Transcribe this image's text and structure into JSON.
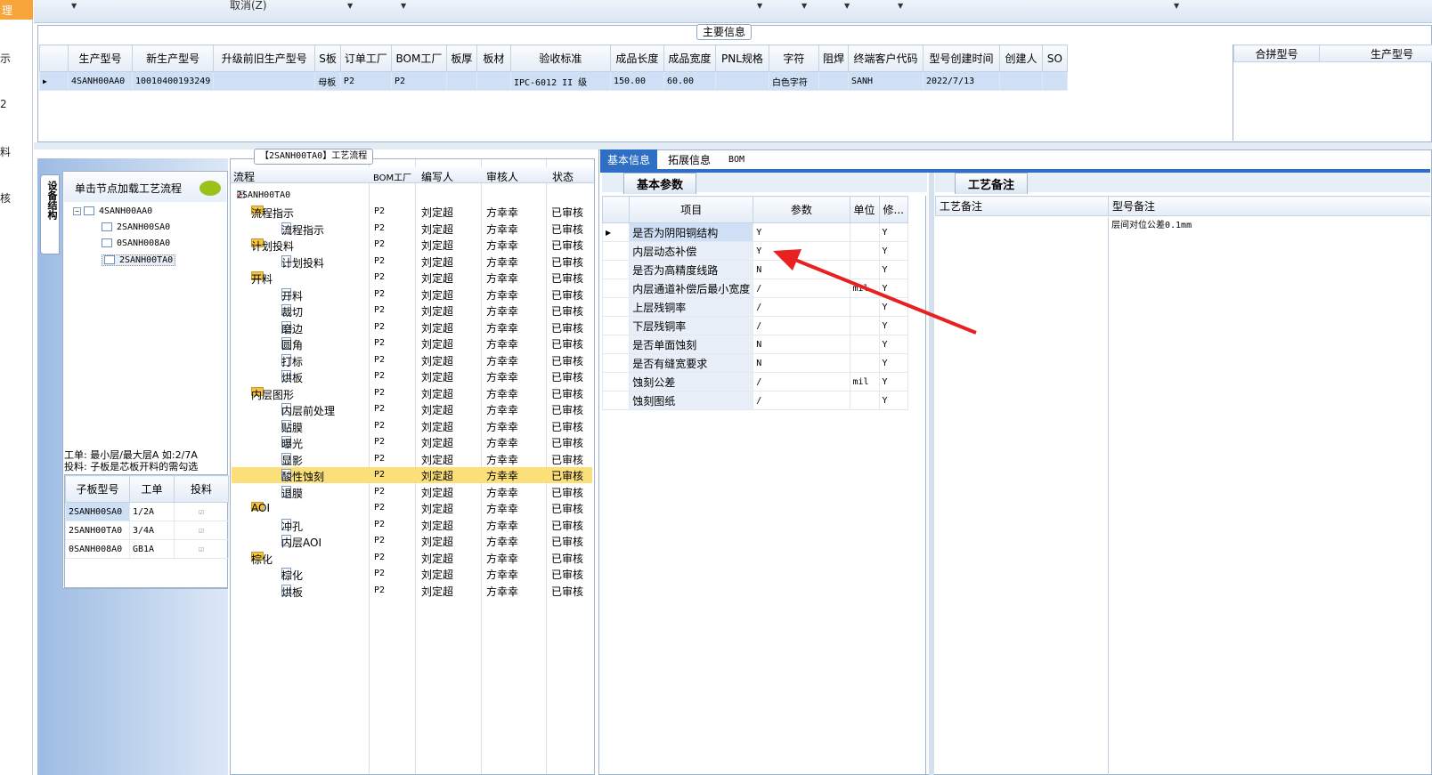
{
  "leftnav": {
    "items": [
      "理",
      "示",
      "2",
      "料",
      "核"
    ]
  },
  "topbar": {
    "cancel_label": "取消(Z)"
  },
  "main_info": {
    "legend": "主要信息",
    "columns": [
      "生产型号",
      "新生产型号",
      "升级前旧生产型号",
      "S板",
      "订单工厂",
      "BOM工厂",
      "板厚",
      "板材",
      "验收标准",
      "成品长度",
      "成品宽度",
      "PNL规格",
      "字符",
      "阻焊",
      "终端客户代码",
      "型号创建时间",
      "创建人",
      "SO"
    ],
    "row": [
      "4SANH00AA0",
      "10010400193249",
      "",
      "母板",
      "P2",
      "P2",
      "",
      "",
      "IPC-6012 II 级",
      "150.00",
      "60.00",
      "",
      "白色字符",
      "",
      "SANH",
      "2022/7/13",
      "",
      ""
    ],
    "right_columns": [
      "合拼型号",
      "生产型号"
    ]
  },
  "structure": {
    "vtab": "设备结构",
    "hint": "单击节点加载工艺流程",
    "tree": [
      "4SANH00AA0",
      "2SANH00SA0",
      "0SANH008A0",
      "2SANH00TA0"
    ],
    "note_line1": "工单: 最小层/最大层A 如:2/7A",
    "note_line2": "投料: 子板是芯板开料的需勾选",
    "sub_columns": [
      "子板型号",
      "工单",
      "投料"
    ],
    "sub_rows": [
      {
        "model": "2SANH00SA0",
        "order": "1/2A"
      },
      {
        "model": "2SANH00TA0",
        "order": "3/4A"
      },
      {
        "model": "0SANH008A0",
        "order": "GB1A"
      }
    ]
  },
  "flow": {
    "legend": "【2SANH00TA0】工艺流程",
    "columns": [
      "流程",
      "BOM工厂",
      "编写人",
      "审核人",
      "状态"
    ],
    "root": "2SANH00TA0",
    "rows": [
      {
        "name": "流程指示",
        "level": 1,
        "folder": true,
        "bom": "P2",
        "author": "刘定超",
        "reviewer": "方幸幸",
        "status": "已审核"
      },
      {
        "name": "流程指示",
        "level": 2,
        "folder": false,
        "bom": "P2",
        "author": "刘定超",
        "reviewer": "方幸幸",
        "status": "已审核"
      },
      {
        "name": "计划投料",
        "level": 1,
        "folder": true,
        "bom": "P2",
        "author": "刘定超",
        "reviewer": "方幸幸",
        "status": "已审核"
      },
      {
        "name": "计划投料",
        "level": 2,
        "folder": false,
        "bom": "P2",
        "author": "刘定超",
        "reviewer": "方幸幸",
        "status": "已审核"
      },
      {
        "name": "开料",
        "level": 1,
        "folder": true,
        "bom": "P2",
        "author": "刘定超",
        "reviewer": "方幸幸",
        "status": "已审核"
      },
      {
        "name": "开料",
        "level": 2,
        "folder": false,
        "bom": "P2",
        "author": "刘定超",
        "reviewer": "方幸幸",
        "status": "已审核"
      },
      {
        "name": "裁切",
        "level": 2,
        "folder": false,
        "bom": "P2",
        "author": "刘定超",
        "reviewer": "方幸幸",
        "status": "已审核"
      },
      {
        "name": "磨边",
        "level": 2,
        "folder": false,
        "bom": "P2",
        "author": "刘定超",
        "reviewer": "方幸幸",
        "status": "已审核"
      },
      {
        "name": "圆角",
        "level": 2,
        "folder": false,
        "bom": "P2",
        "author": "刘定超",
        "reviewer": "方幸幸",
        "status": "已审核"
      },
      {
        "name": "打标",
        "level": 2,
        "folder": false,
        "bom": "P2",
        "author": "刘定超",
        "reviewer": "方幸幸",
        "status": "已审核"
      },
      {
        "name": "烘板",
        "level": 2,
        "folder": false,
        "bom": "P2",
        "author": "刘定超",
        "reviewer": "方幸幸",
        "status": "已审核"
      },
      {
        "name": "内层图形",
        "level": 1,
        "folder": true,
        "bom": "P2",
        "author": "刘定超",
        "reviewer": "方幸幸",
        "status": "已审核"
      },
      {
        "name": "内层前处理",
        "level": 2,
        "folder": false,
        "bom": "P2",
        "author": "刘定超",
        "reviewer": "方幸幸",
        "status": "已审核"
      },
      {
        "name": "贴膜",
        "level": 2,
        "folder": false,
        "bom": "P2",
        "author": "刘定超",
        "reviewer": "方幸幸",
        "status": "已审核"
      },
      {
        "name": "曝光",
        "level": 2,
        "folder": false,
        "bom": "P2",
        "author": "刘定超",
        "reviewer": "方幸幸",
        "status": "已审核"
      },
      {
        "name": "显影",
        "level": 2,
        "folder": false,
        "bom": "P2",
        "author": "刘定超",
        "reviewer": "方幸幸",
        "status": "已审核"
      },
      {
        "name": "酸性蚀刻",
        "level": 2,
        "folder": false,
        "bom": "P2",
        "author": "刘定超",
        "reviewer": "方幸幸",
        "status": "已审核",
        "selected": true
      },
      {
        "name": "退膜",
        "level": 2,
        "folder": false,
        "bom": "P2",
        "author": "刘定超",
        "reviewer": "方幸幸",
        "status": "已审核"
      },
      {
        "name": "AOI",
        "level": 1,
        "folder": true,
        "bom": "P2",
        "author": "刘定超",
        "reviewer": "方幸幸",
        "status": "已审核"
      },
      {
        "name": "冲孔",
        "level": 2,
        "folder": false,
        "bom": "P2",
        "author": "刘定超",
        "reviewer": "方幸幸",
        "status": "已审核"
      },
      {
        "name": "内层AOI",
        "level": 2,
        "folder": false,
        "bom": "P2",
        "author": "刘定超",
        "reviewer": "方幸幸",
        "status": "已审核"
      },
      {
        "name": "棕化",
        "level": 1,
        "folder": true,
        "bom": "P2",
        "author": "刘定超",
        "reviewer": "方幸幸",
        "status": "已审核"
      },
      {
        "name": "棕化",
        "level": 2,
        "folder": false,
        "bom": "P2",
        "author": "刘定超",
        "reviewer": "方幸幸",
        "status": "已审核"
      },
      {
        "name": "烘板",
        "level": 2,
        "folder": false,
        "bom": "P2",
        "author": "刘定超",
        "reviewer": "方幸幸",
        "status": "已审核"
      }
    ]
  },
  "right": {
    "tabs": [
      "基本信息",
      "拓展信息",
      "BOM"
    ],
    "subtab_basic": "基本参数",
    "subtab_process": "工艺备注",
    "param_columns": [
      "项目",
      "参数",
      "单位",
      "修..."
    ],
    "params": [
      {
        "item": "是否为阴阳铜结构",
        "value": "Y",
        "unit": "",
        "mod": "Y"
      },
      {
        "item": "内层动态补偿",
        "value": "Y",
        "unit": "",
        "mod": "Y"
      },
      {
        "item": "是否为高精度线路",
        "value": "N",
        "unit": "",
        "mod": "Y"
      },
      {
        "item": "内层通道补偿后最小宽度",
        "value": "/",
        "unit": "mil",
        "mod": "Y"
      },
      {
        "item": "上层残铜率",
        "value": "/",
        "unit": "",
        "mod": "Y"
      },
      {
        "item": "下层残铜率",
        "value": "/",
        "unit": "",
        "mod": "Y"
      },
      {
        "item": "是否单面蚀刻",
        "value": "N",
        "unit": "",
        "mod": "Y"
      },
      {
        "item": "是否有缝宽要求",
        "value": "N",
        "unit": "",
        "mod": "Y"
      },
      {
        "item": "蚀刻公差",
        "value": "/",
        "unit": "mil",
        "mod": "Y"
      },
      {
        "item": "蚀刻图纸",
        "value": "/",
        "unit": "",
        "mod": "Y"
      }
    ],
    "remark_columns": [
      "工艺备注",
      "型号备注"
    ],
    "remark_value": "层间对位公差0.1mm"
  },
  "colors": {
    "accent": "#2e6fc5",
    "selected": "#cfe0f6",
    "highlight": "#fbe07a",
    "arrow": "#e8201f"
  }
}
